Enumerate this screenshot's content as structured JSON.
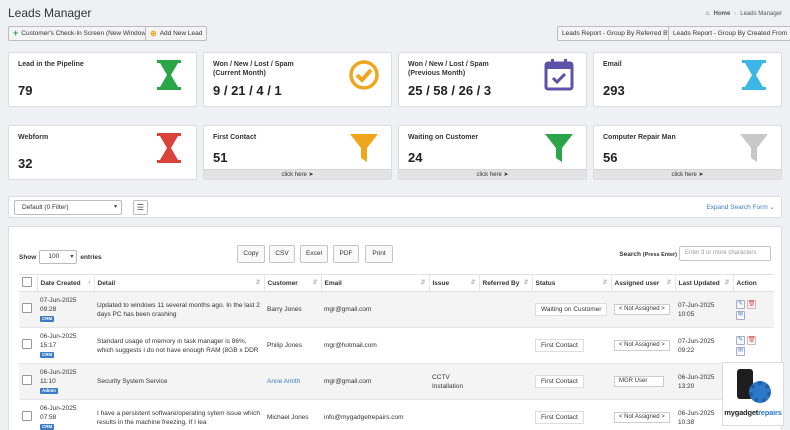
{
  "header": {
    "title": "Leads Manager",
    "breadcrumb_home": "Home",
    "breadcrumb_current": "Leads Manager"
  },
  "toolbar": {
    "checkin_label": "Customer's Check-In Screen (New Window)",
    "add_lead_label": "Add New Lead",
    "report_referred_label": "Leads Report - Group By Referred By",
    "report_created_label": "Leads Report - Group By Created From"
  },
  "stats": [
    {
      "label": "Lead in the Pipeline",
      "value": "79",
      "icon": "hourglass-icon",
      "color": "#2aa54a"
    },
    {
      "label": "Won / New / Lost / Spam\n(Current Month)",
      "value": "9 / 21 / 4 / 1",
      "icon": "check-circle-icon",
      "color": "#f0a61c"
    },
    {
      "label": "Won / New / Lost / Spam\n(Previous Month)",
      "value": "25 / 58 / 26 / 3",
      "icon": "calendar-check-icon",
      "color": "#5b53a8"
    },
    {
      "label": "Email",
      "value": "293",
      "icon": "hourglass-icon",
      "color": "#3bb6e6"
    },
    {
      "label": "Webform",
      "value": "32",
      "icon": "hourglass-icon",
      "color": "#d9433a"
    },
    {
      "label": "First Contact",
      "value": "51",
      "icon": "funnel-icon",
      "color": "#f0a61c",
      "link": "click here"
    },
    {
      "label": "Waiting on Customer",
      "value": "24",
      "icon": "funnel-icon",
      "color": "#2aa54a",
      "link": "click here"
    },
    {
      "label": "Computer Repair Man",
      "value": "56",
      "icon": "funnel-icon",
      "color": "#c8c8c8",
      "link": "click here"
    }
  ],
  "filter": {
    "selected": "Default (0 Filter)",
    "expand_label": "Expand Search Form"
  },
  "table_controls": {
    "show_label": "Show",
    "entries_value": "100",
    "entries_label": "entries",
    "buttons": [
      "Copy",
      "CSV",
      "Excel",
      "PDF",
      "Print"
    ],
    "search_label": "Search",
    "search_hint": "(Press Enter)",
    "search_placeholder": "Enter 3 or more characters"
  },
  "columns": [
    "Date Created",
    "Detail",
    "Customer",
    "Email",
    "Issue",
    "Referred By",
    "Status",
    "Assigned user",
    "Last Updated",
    "Action"
  ],
  "rows": [
    {
      "date": "07-Jun-2025",
      "time": "09:28",
      "tag": "CRM",
      "detail": "Updated to windows 11 several months ago. In the last 2 days PC has been crashing",
      "customer": "Barry Jones",
      "email": "mgr@gmail.com",
      "issue": "",
      "referred": "",
      "status": "Waiting on Customer",
      "assigned": "< Not Assigned >",
      "updated_date": "07-Jun-2025",
      "updated_time": "10:05"
    },
    {
      "date": "06-Jun-2025",
      "time": "15:17",
      "tag": "CRM",
      "detail": "Standard usage of memory in task manager is 86%, which suggests I do not have enough RAM (8GB x DDR",
      "customer": "Philip Jones",
      "email": "mgr@hotmail.com",
      "issue": "",
      "referred": "",
      "status": "First Contact",
      "assigned": "< Not Assigned >",
      "updated_date": "07-Jun-2025",
      "updated_time": "09:22"
    },
    {
      "date": "06-Jun-2025",
      "time": "11:10",
      "tag": "Admin",
      "detail": "Security System Service",
      "customer": "Anne Amith",
      "email": "mgr@gmail.com",
      "issue": "CCTV Installation",
      "referred": "",
      "status": "First Contact",
      "assigned": "MGR User",
      "updated_date": "06-Jun-2025",
      "updated_time": "13:20"
    },
    {
      "date": "06-Jun-2025",
      "time": "07:58",
      "tag": "CRM",
      "detail": "I have a persistent software/operating sytem issue which results in the machine freezing. If I lea",
      "customer": "Michael Jones",
      "email": "info@mygadgetrepairs.com",
      "issue": "",
      "referred": "",
      "status": "First Contact",
      "assigned": "< Not Assigned >",
      "updated_date": "06-Jun-2025",
      "updated_time": "10:38"
    }
  ],
  "logo": {
    "brand_a": "mygadget",
    "brand_b": "repairs"
  }
}
